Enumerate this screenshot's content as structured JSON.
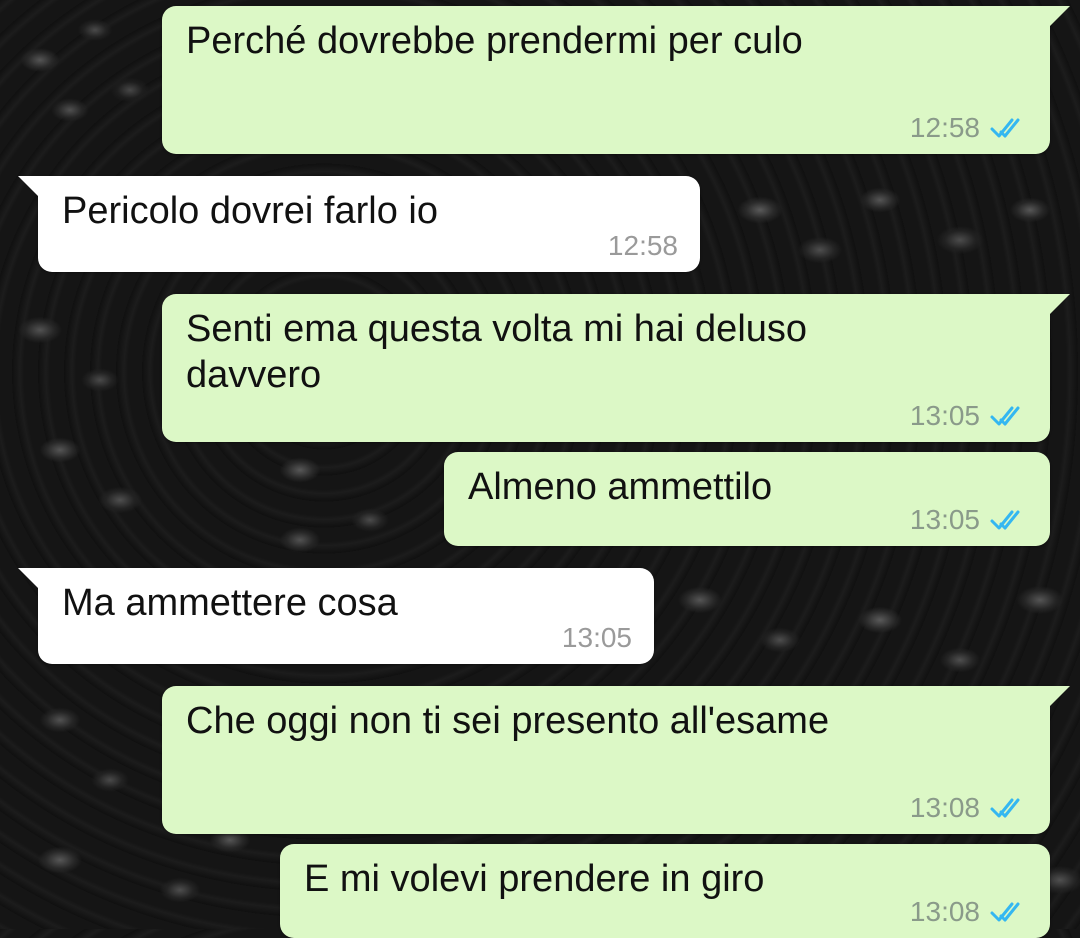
{
  "colors": {
    "outgoing_bubble": "#dcf8c6",
    "incoming_bubble": "#ffffff",
    "read_ticks": "#34b7f1",
    "timestamp": "#8a9a8a"
  },
  "messages": [
    {
      "direction": "out",
      "text": "Perché dovrebbe prendermi per culo",
      "time": "12:58",
      "status": "read"
    },
    {
      "direction": "in",
      "text": "Pericolo dovrei farlo io",
      "time": "12:58"
    },
    {
      "direction": "out",
      "text": "Senti ema questa volta mi hai deluso davvero",
      "time": "13:05",
      "status": "read"
    },
    {
      "direction": "out",
      "text": "Almeno ammettilo",
      "time": "13:05",
      "status": "read"
    },
    {
      "direction": "in",
      "text": "Ma ammettere cosa",
      "time": "13:05"
    },
    {
      "direction": "out",
      "text": "Che oggi non ti sei presento all'esame",
      "time": "13:08",
      "status": "read"
    },
    {
      "direction": "out",
      "text": "E mi volevi prendere in giro",
      "time": "13:08",
      "status": "read"
    }
  ]
}
